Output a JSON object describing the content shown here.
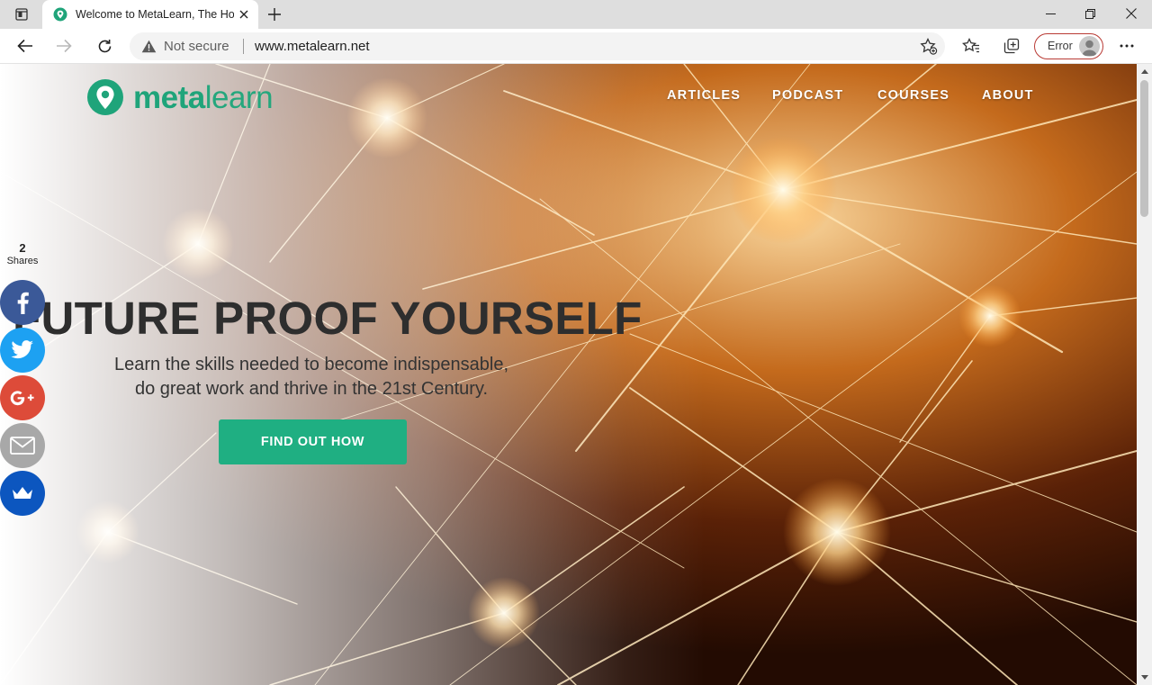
{
  "browser": {
    "tab_title": "Welcome to MetaLearn, The Hor",
    "security_label": "Not secure",
    "url": "www.metalearn.net",
    "profile_status": "Error"
  },
  "site": {
    "logo_bold": "meta",
    "logo_light": "learn",
    "nav": [
      "ARTICLES",
      "PODCAST",
      "COURSES",
      "ABOUT"
    ],
    "headline": "FUTURE PROOF YOURSELF",
    "subtitle_line1": "Learn the skills needed to become indispensable,",
    "subtitle_line2": "do great work and thrive in the 21st Century.",
    "cta_label": "FIND OUT HOW"
  },
  "share": {
    "count": "2",
    "label": "Shares",
    "buttons": [
      "facebook",
      "twitter",
      "google-plus",
      "email",
      "sumome"
    ]
  },
  "colors": {
    "brand_green": "#1fa47a",
    "cta_green": "#1faf82",
    "facebook": "#3b5998",
    "twitter": "#1da1f2",
    "google_plus": "#dd4b39",
    "email": "#a8a8a8",
    "sumome": "#0c56bf"
  }
}
